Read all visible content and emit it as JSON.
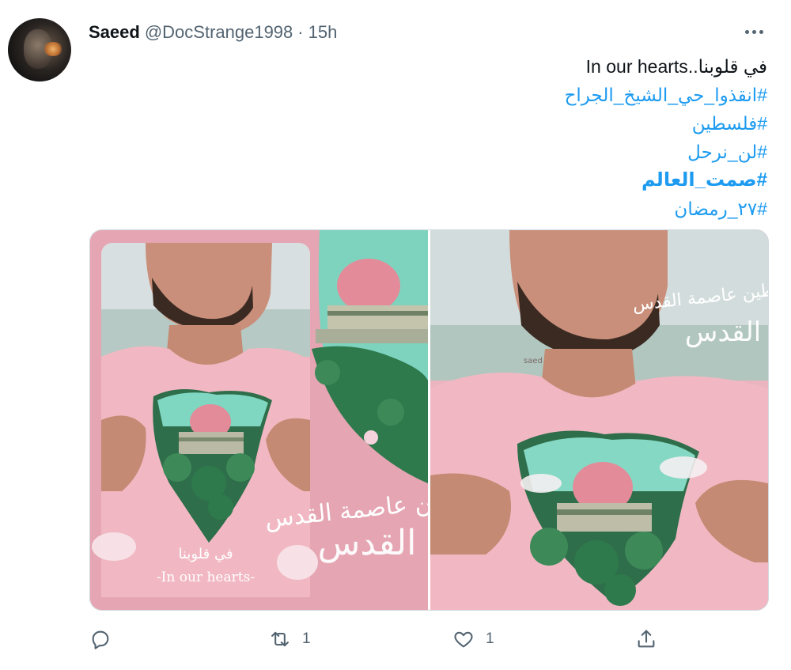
{
  "tweet": {
    "author_name": "Saeed",
    "handle": "@DocStrange1998",
    "separator": "·",
    "time": "15h",
    "lines": [
      {
        "text": "في قلوبنا..In our hearts",
        "type": "plain"
      },
      {
        "text": "#انقذوا_حي_الشيخ_الجراح",
        "type": "hashtag"
      },
      {
        "text": "#فلسطين",
        "type": "hashtag"
      },
      {
        "text": "#لن_نرحل",
        "type": "hashtag"
      },
      {
        "text": "#صمت_العالم",
        "type": "hashtag-bold"
      },
      {
        "text": "#٢٧_رمضان",
        "type": "hashtag"
      }
    ],
    "media": {
      "left_caption_ar": "في قلوبنا",
      "left_caption_en": "-In our hearts-",
      "calligraphy_text": "فلسطين عاصمة القدس",
      "watermark": "saed"
    },
    "actions": {
      "reply_icon": "reply-icon",
      "retweet_icon": "retweet-icon",
      "retweet_count": "1",
      "like_icon": "heart-icon",
      "like_count": "1",
      "share_icon": "share-icon"
    }
  },
  "colors": {
    "accent": "#1d9bf0",
    "muted": "#536471",
    "text": "#0f1419",
    "image_pink": "#e7a9b5"
  }
}
